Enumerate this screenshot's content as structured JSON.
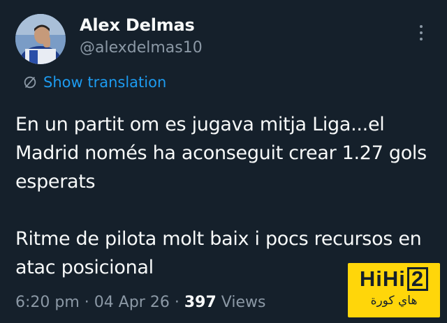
{
  "tweet": {
    "author": {
      "name": "Alex Delmas",
      "handle": "@alexdelmas10"
    },
    "translate_label": "Show translation",
    "text_paragraphs": [
      "En un partit om es jugava mitja Liga...el Madrid només ha aconseguit crear 1.27 gols esperats",
      "Ritme de pilota molt baix i pocs recursos en atac posicional"
    ],
    "time": "6:20 pm",
    "date": "04 Apr 26",
    "separator": "·",
    "views_count": "397",
    "views_label": "Views"
  },
  "watermark": {
    "logo_prefix": "HiHi",
    "logo_boxed": "2",
    "subtitle": "هاي كورة"
  },
  "colors": {
    "background": "#15202b",
    "primary_text": "#f7f9f9",
    "secondary_text": "#8b98a5",
    "link": "#1d9bf0",
    "watermark_bg": "#ffd60a"
  },
  "icons": {
    "translate": "translate-slash-circle-icon",
    "more": "more-vertical-icon"
  }
}
